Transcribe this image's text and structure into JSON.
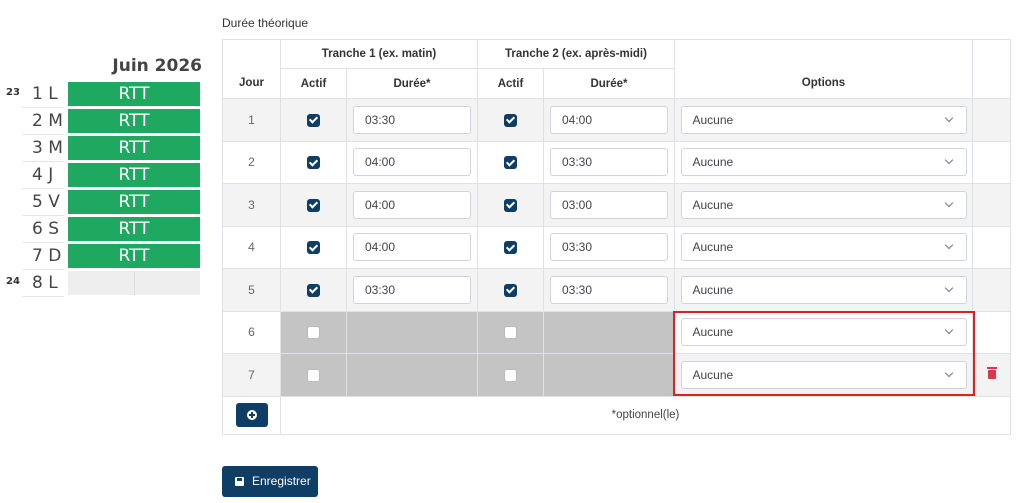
{
  "calendar": {
    "month": "Juin 2026",
    "rows": [
      {
        "week": "23",
        "day": "1 L",
        "event": "RTT"
      },
      {
        "week": "",
        "day": "2 M",
        "event": "RTT"
      },
      {
        "week": "",
        "day": "3 M",
        "event": "RTT"
      },
      {
        "week": "",
        "day": "4 J",
        "event": "RTT"
      },
      {
        "week": "",
        "day": "5 V",
        "event": "RTT"
      },
      {
        "week": "",
        "day": "6 S",
        "event": "RTT"
      },
      {
        "week": "",
        "day": "7 D",
        "event": "RTT"
      },
      {
        "week": "24",
        "day": "8 L",
        "event": ""
      }
    ]
  },
  "form": {
    "section_label": "Durée théorique",
    "headers": {
      "tranche1": "Tranche 1 (ex. matin)",
      "tranche2": "Tranche 2 (ex. après-midi)",
      "jour": "Jour",
      "actif1": "Actif",
      "duree1": "Durée*",
      "actif2": "Actif",
      "duree2": "Durée*",
      "options": "Options"
    },
    "rows": [
      {
        "day": "1",
        "t1_active": true,
        "t1_duration": "03:30",
        "t2_active": true,
        "t2_duration": "04:00",
        "option": "Aucune"
      },
      {
        "day": "2",
        "t1_active": true,
        "t1_duration": "04:00",
        "t2_active": true,
        "t2_duration": "03:30",
        "option": "Aucune"
      },
      {
        "day": "3",
        "t1_active": true,
        "t1_duration": "04:00",
        "t2_active": true,
        "t2_duration": "03:00",
        "option": "Aucune"
      },
      {
        "day": "4",
        "t1_active": true,
        "t1_duration": "04:00",
        "t2_active": true,
        "t2_duration": "03:30",
        "option": "Aucune"
      },
      {
        "day": "5",
        "t1_active": true,
        "t1_duration": "03:30",
        "t2_active": true,
        "t2_duration": "03:30",
        "option": "Aucune"
      },
      {
        "day": "6",
        "t1_active": false,
        "t1_duration": "",
        "t2_active": false,
        "t2_duration": "",
        "option": "Aucune"
      },
      {
        "day": "7",
        "t1_active": false,
        "t1_duration": "",
        "t2_active": false,
        "t2_duration": "",
        "option": "Aucune"
      }
    ],
    "optional_note": "*optionnel(le)",
    "save_label": "Enregistrer"
  },
  "colors": {
    "rtt_green": "#1fa85f",
    "primary": "#0e3d66",
    "highlight_red": "#e02020",
    "delete_red": "#e0344b"
  },
  "icons": {
    "add": "plus-circle-icon",
    "save": "floppy-disk-icon",
    "delete": "trash-icon",
    "dropdown": "chevron-down-icon"
  }
}
